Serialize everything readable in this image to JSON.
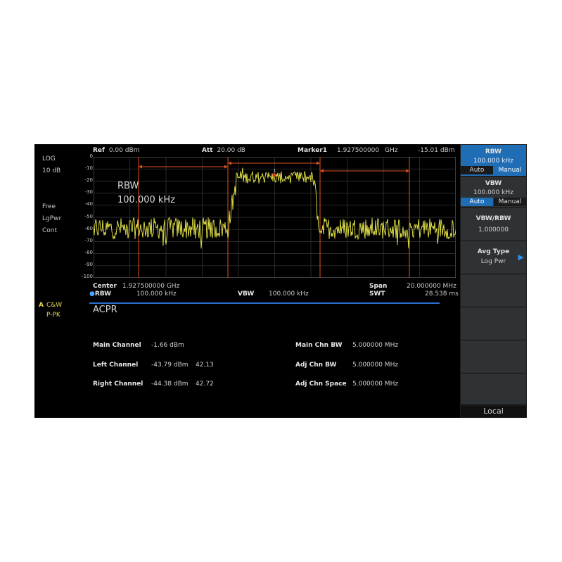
{
  "left_panel": {
    "scale_type": "LOG",
    "scale_div": "10 dB",
    "trigger": "Free",
    "detector": "LgPwr",
    "sweep_mode": "Cont",
    "trace_label": "A",
    "trace_mode": "C&W",
    "trace_detector": "P-PK"
  },
  "header": {
    "ref_label": "Ref",
    "ref_value": "0.00 dBm",
    "att_label": "Att",
    "att_value": "20.00 dB",
    "marker_label": "Marker1",
    "marker_freq": "1.927500000",
    "marker_freq_unit": "GHz",
    "marker_level": "-15.01 dBm"
  },
  "graph": {
    "y_ticks": [
      "0",
      "-10",
      "-20",
      "-30",
      "-40",
      "-50",
      "-60",
      "-70",
      "-80",
      "-90",
      "-100"
    ],
    "annotation_line1": "RBW",
    "annotation_line2": "100.000  kHz",
    "marker_number": "1"
  },
  "footer": {
    "center_label": "Center",
    "center_value": "1.927500000  GHz",
    "span_label": "Span",
    "span_value": "20.000000  MHz",
    "rbw_label": "RBW",
    "rbw_value": "100.000  kHz",
    "vbw_label": "VBW",
    "vbw_value": "100.000  kHz",
    "swt_label": "SWT",
    "swt_value": "28.538 ms"
  },
  "acpr": {
    "title": "ACPR",
    "rows": [
      {
        "label": "Main Channel",
        "value": "-1.66 dBm",
        "ratio": "",
        "param_label": "Main Chn BW",
        "param_value": "5.000000  MHz"
      },
      {
        "label": "Left Channel",
        "value": "-43.79 dBm",
        "ratio": "42.13",
        "param_label": "Adj Chn BW",
        "param_value": "5.000000  MHz"
      },
      {
        "label": "Right Channel",
        "value": "-44.38 dBm",
        "ratio": "42.72",
        "param_label": "Adj Chn Space",
        "param_value": "5.000000  MHz"
      }
    ]
  },
  "softkeys": {
    "rbw_title": "RBW",
    "rbw_value": "100.000  kHz",
    "rbw_auto": "Auto",
    "rbw_manual": "Manual",
    "vbw_title": "VBW",
    "vbw_value": "100.000  kHz",
    "vbw_auto": "Auto",
    "vbw_manual": "Manual",
    "ratio_title": "VBW/RBW",
    "ratio_value": "1.000000",
    "avg_title": "Avg Type",
    "avg_value": "Log Pwr",
    "local_label": "Local"
  },
  "colors": {
    "trace": "#e8e84a",
    "channel_lines": "#e05020",
    "accent_blue": "#1f6db5",
    "grid": "#3a3a3a"
  }
}
